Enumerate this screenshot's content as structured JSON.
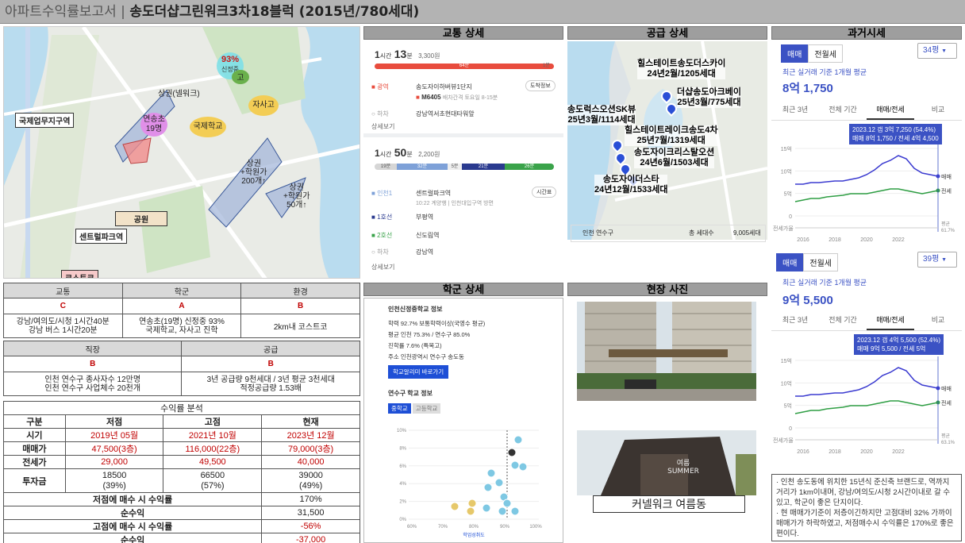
{
  "title": {
    "prefix": "아파트수익률보고서",
    "separator": "|",
    "main": "송도더샵그린워크3차18블럭 (2015년/780세대)"
  },
  "map": {
    "labels": {
      "school_pct": "93%",
      "school_name": "신정중",
      "high": "고",
      "commercial_nelim": "상권(넬워크)",
      "elementary": "연송초",
      "elementary_count": "19명",
      "intl_business": "국제업무지구역",
      "jasago": "자사고",
      "intl_school": "국제학교",
      "commercial1_a": "상권",
      "commercial1_b": "+학원가",
      "commercial1_c": "200개↑",
      "commercial2_a": "상권",
      "commercial2_b": "+학원가",
      "commercial2_c": "50개↑",
      "park": "공원",
      "central_park": "센트럴파크역",
      "costco": "코스트코"
    }
  },
  "grades": {
    "headers": [
      "교통",
      "학군",
      "환경"
    ],
    "grades": [
      "C",
      "A",
      "B"
    ],
    "details": [
      "강남/여의도/시청 1시간40분\n강남 버스 1시간20분",
      "연송초(19명) 신정중 93%\n국제학교, 자사고 진학",
      "2km내 코스트코"
    ],
    "headers2": [
      "직장",
      "공급"
    ],
    "grades2": [
      "B",
      "B"
    ],
    "details2": [
      "인천 연수구 종사자수 12만명\n인천 연수구 사업체수 20천개",
      "3년 공급량 9천세대 / 3년 평균 3천세대\n적정공급량 1.53배"
    ]
  },
  "profit": {
    "title": "수익률 분석",
    "cols": [
      "구분",
      "저점",
      "고점",
      "현재"
    ],
    "time": {
      "label": "시기",
      "values": [
        "2019년 05월",
        "2021년 10월",
        "2023년 12월"
      ]
    },
    "sale": {
      "label": "매매가",
      "values": [
        "47,500(3층)",
        "116,000(22층)",
        "79,000(3층)"
      ]
    },
    "jeonse": {
      "label": "전세가",
      "values": [
        "29,000",
        "49,500",
        "40,000"
      ]
    },
    "invest": {
      "label": "투자금",
      "values": [
        "18500",
        "66500",
        "39000"
      ],
      "pct": [
        "(39%)",
        "(57%)",
        "(49%)"
      ]
    },
    "low_buy": {
      "label": "저점에 매수 시 수익률",
      "value": "170%"
    },
    "low_net": {
      "label": "순수익",
      "value": "31,500"
    },
    "high_buy": {
      "label": "고점에 매수 시 수익률",
      "value": "-56%"
    },
    "high_net": {
      "label": "순수익",
      "value": "-37,000"
    }
  },
  "transport": {
    "title": "교통 상세",
    "route1": {
      "h": "1",
      "h_unit": "시간",
      "m": "13",
      "m_unit": "분",
      "fare": "3,300원",
      "seg": "64분",
      "seg_end": "1분"
    },
    "bus_type": "광역",
    "bus_stop": "송도자이하버뷰1단지",
    "bus_num": "M6405",
    "bus_note": "배차간격 토요일 8-15분",
    "bus_btn": "도착정보",
    "getoff_label": "하차",
    "getoff": "강남역서초현대타워앞",
    "more1": "상세보기",
    "route2": {
      "h": "1",
      "h_unit": "시간",
      "m": "50",
      "m_unit": "분",
      "fare": "2,200원",
      "segs": [
        "19분",
        "32분",
        "5분",
        "21분",
        "26분"
      ]
    },
    "line1": "인천1",
    "st1": "센트럴파크역",
    "st1_note": "10:22 계양행 | 인천대입구역 방면",
    "st1_btn": "시간표",
    "line2": "1호선",
    "st2": "부평역",
    "line3": "2호선",
    "st3": "신도림역",
    "getoff2_label": "하차",
    "getoff2": "강남역",
    "more2": "상세보기"
  },
  "supply": {
    "title": "공급 상세",
    "items": [
      {
        "name": "힐스테이트송도더스카이",
        "info": "24년2월/1205세대"
      },
      {
        "name": "더샵송도아크베이",
        "info": "25년3월/775세대"
      },
      {
        "name": "송도럭스오션SK뷰",
        "info": "25년3월/1114세대"
      },
      {
        "name": "힐스테이트레이크송도4차",
        "info": "25년7월/1319세대"
      },
      {
        "name": "송도자이크리스탈오션",
        "info": "24년6월/1503세대"
      },
      {
        "name": "송도자이더스타",
        "info": "24년12월/1533세대"
      }
    ],
    "footer_area": "인천 연수구",
    "footer_label": "총 세대수",
    "footer_value": "9,005세대"
  },
  "history": {
    "title": "과거시세",
    "tab_sale": "매매",
    "tab_jeonse": "전월세",
    "p1": {
      "size": "34평",
      "avg_label": "최근 실거래 기준 1개월 평균",
      "price": "8억 1,750",
      "tooltip1": "2023.12 갭 3억 7,250 (54.4%)",
      "tooltip2": "매매 8억 1,750 / 전세 4억 4,500"
    },
    "p2": {
      "size": "39평",
      "avg_label": "최근 실거래 기준 1개월 평균",
      "price": "9억 5,500",
      "tooltip1": "2023.12 갭 4억 5,500 (52.4%)",
      "tooltip2": "매매 9억 5,500 / 전세 5억"
    },
    "subtabs": [
      "최근 3년",
      "전체 기간",
      "매매/전세",
      "비교"
    ],
    "y_ticks": [
      "15억",
      "10억",
      "5억",
      "0"
    ],
    "x_ticks": [
      "2016",
      "2018",
      "2020",
      "2022"
    ],
    "legend_sale": "매매",
    "legend_jeonse": "전세",
    "legend_avg": "평균",
    "avg1": "61.7%",
    "avg2": "63.1%",
    "gap_label": "전세가율"
  },
  "school": {
    "title": "학군 상세",
    "h1": "인천신정중학교 정보",
    "r1": "학력 92.7% 보통학력이상(국영수 평균)",
    "r2": "평균 인천 75.3% / 연수구 85.0%",
    "r3": "진학률 7.6% (특목고)",
    "r4": "주소 인천광역시 연수구 송도동",
    "btn": "학교알리미 바로가기",
    "h2": "연수구 학교 정보",
    "tab1": "중학교",
    "tab2": "고등학교",
    "y_ticks": [
      "10%",
      "8%",
      "6%",
      "4%",
      "2%",
      "0%"
    ],
    "x_ticks": [
      "60%",
      "70%",
      "80%",
      "90%",
      "100%"
    ],
    "xlabel": "학업성취도"
  },
  "photos": {
    "title": "현장 사진",
    "caption": "커넬워크 여름동",
    "sign": "여름 SUMMER"
  },
  "comment": {
    "l1": "· 인천 송도동에 위치한 15년식 준신축 브랜드로, 역까지 거리가 1km이내며, 강남/여의도/시청 2시간이내로 갈 수 있고, 학군이 좋은 단지이다.",
    "l2": "· 현 매매가기준이 저층이긴하지만 고점대비 32% 가까이 매매가가 하락하였고, 저점매수시 수익률은 170%로 좋은 편이다."
  }
}
